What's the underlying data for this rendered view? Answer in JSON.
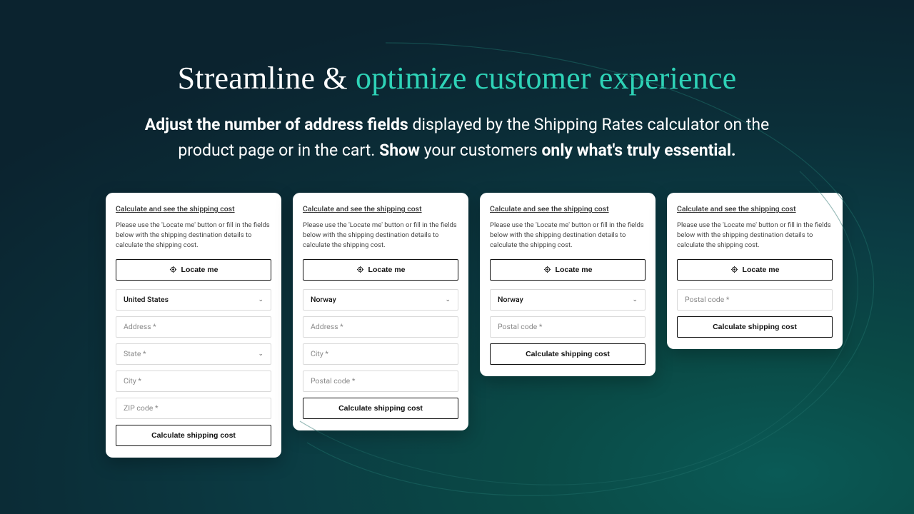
{
  "hero": {
    "title_prefix": "Streamline & ",
    "title_accent": "optimize customer experience",
    "line1_b1": "Adjust the number of address fields",
    "line1_rest": " displayed by the Shipping Rates calculator on the",
    "line2_a": "product page or in the cart. ",
    "line2_b1": "Show",
    "line2_mid": " your customers ",
    "line2_b2": "only what's truly essential."
  },
  "common": {
    "card_title": "Calculate and see the shipping cost",
    "card_desc": "Please use the 'Locate me' button or fill in the fields below with the shipping destination details to calculate the shipping cost.",
    "locate_label": "Locate me",
    "calc_label": "Calculate shipping cost"
  },
  "cards": [
    {
      "country": "United States",
      "fields": [
        {
          "type": "select",
          "value": "United States"
        },
        {
          "type": "input",
          "placeholder": "Address *"
        },
        {
          "type": "select-placeholder",
          "placeholder": "State *"
        },
        {
          "type": "input",
          "placeholder": "City *"
        },
        {
          "type": "input",
          "placeholder": "ZIP code *"
        }
      ]
    },
    {
      "country": "Norway",
      "fields": [
        {
          "type": "select",
          "value": "Norway"
        },
        {
          "type": "input",
          "placeholder": "Address *"
        },
        {
          "type": "input",
          "placeholder": "City *"
        },
        {
          "type": "input",
          "placeholder": "Postal code *"
        }
      ]
    },
    {
      "country": "Norway",
      "fields": [
        {
          "type": "select",
          "value": "Norway"
        },
        {
          "type": "input",
          "placeholder": "Postal code *"
        }
      ]
    },
    {
      "country": null,
      "fields": [
        {
          "type": "input",
          "placeholder": "Postal code *"
        }
      ]
    }
  ]
}
